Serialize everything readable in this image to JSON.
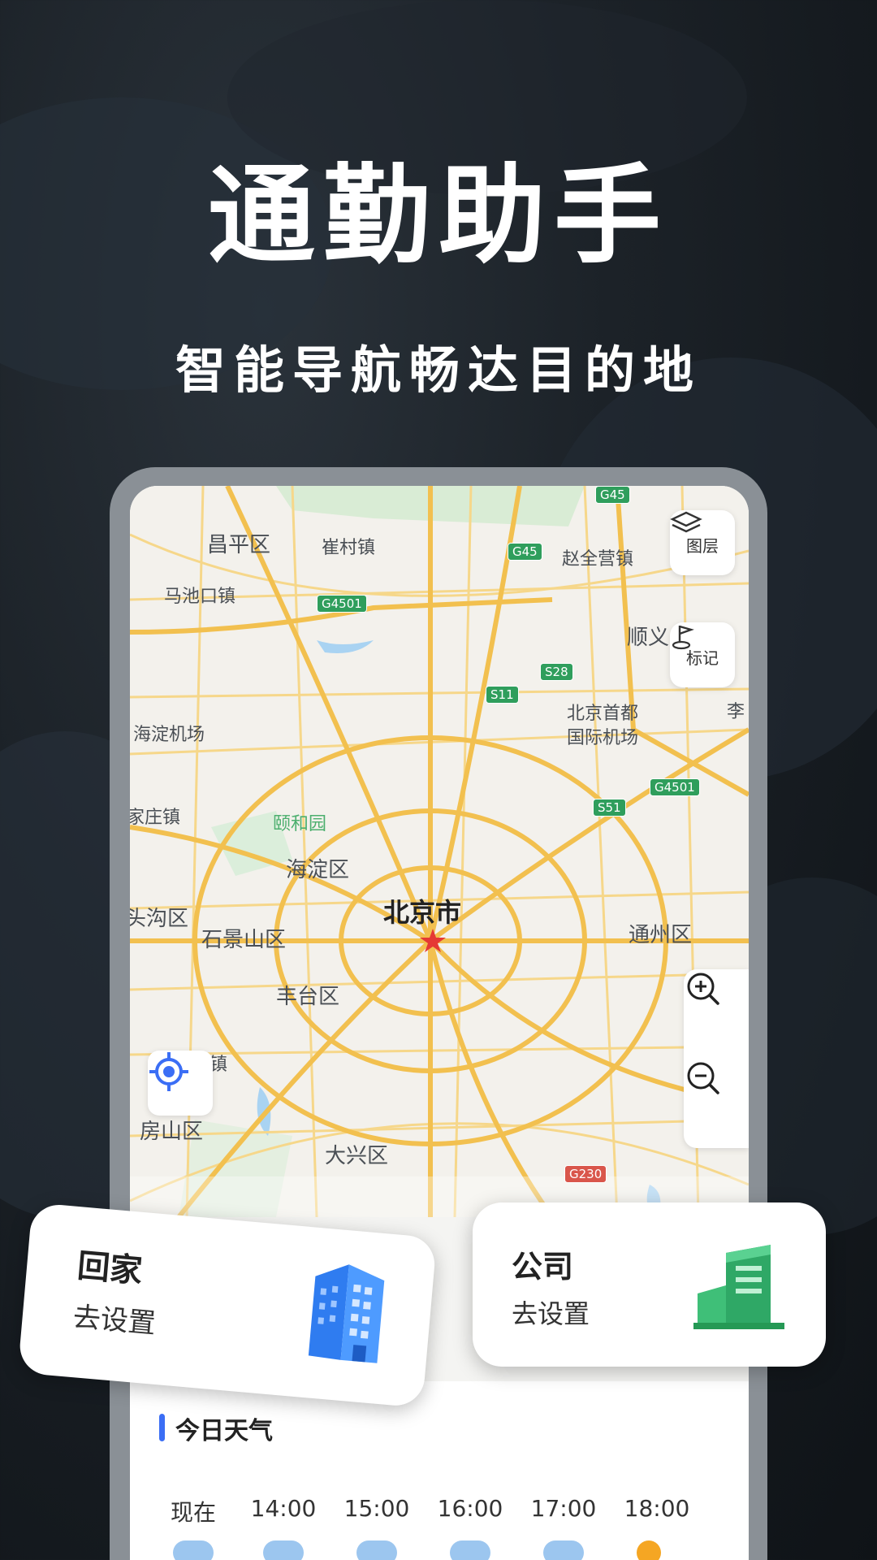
{
  "promo": {
    "headline": "通勤助手",
    "subheadline": "智能导航畅达目的地"
  },
  "map": {
    "controls": {
      "layers_label": "图层",
      "marker_label": "标记"
    },
    "labels": {
      "changping": "昌平区",
      "cuncun": "崔村镇",
      "zhaoquanying": "赵全营镇",
      "machikou": "马池口镇",
      "shunyi": "顺义",
      "haidian_airport": "海淀机场",
      "capital_airport_1": "北京首都",
      "capital_airport_2": "国际机场",
      "li": "李",
      "yiheyuan": "颐和园",
      "zhuangzhen": "家庄镇",
      "haidian": "海淀区",
      "mentougou": "头沟区",
      "beijing": "北京市",
      "shijingshan": "石景山区",
      "tongzhou": "通州区",
      "fengtai": "丰台区",
      "zhen": "镇",
      "fangshan": "房山区",
      "daxing": "大兴区"
    },
    "roads": {
      "g45_top": "G45",
      "g45": "G45",
      "g4501_left": "G4501",
      "s28": "S28",
      "s11": "S11",
      "g4501_right": "G4501",
      "s51": "S51",
      "g230": "G230"
    },
    "colors": {
      "road_major": "#f2c04f",
      "road_minor": "#f6d78a",
      "land": "#f3f1ec",
      "green": "#d9ecd5",
      "water": "#a9d3f2"
    }
  },
  "cards": {
    "home": {
      "title": "回家",
      "subtitle": "去设置",
      "icon": "blue-building-icon"
    },
    "work": {
      "title": "公司",
      "subtitle": "去设置",
      "icon": "green-building-icon"
    }
  },
  "weather": {
    "title": "今日天气",
    "hours": [
      "现在",
      "14:00",
      "15:00",
      "16:00",
      "17:00",
      "18:00"
    ],
    "accent": "#3b6ef5"
  }
}
